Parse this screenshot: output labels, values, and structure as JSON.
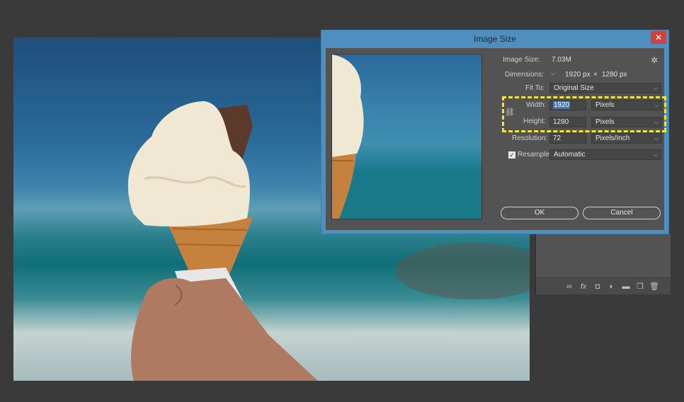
{
  "dialog": {
    "title": "Image Size",
    "close_label": "✕",
    "image_size_label": "Image Size:",
    "image_size_value": "7.03M",
    "dimensions_label": "Dimensions:",
    "dimensions_width": "1920 px",
    "dimensions_times": "×",
    "dimensions_height": "1280 px",
    "fit_to_label": "Fit To:",
    "fit_to_value": "Original Size",
    "width_label": "Width:",
    "width_value": "1920",
    "width_unit": "Pixels",
    "height_label": "Height:",
    "height_value": "1280",
    "height_unit": "Pixels",
    "resolution_label": "Resolution:",
    "resolution_value": "72",
    "resolution_unit": "Pixels/Inch",
    "resample_label": "Resample:",
    "resample_checked": true,
    "resample_value": "Automatic",
    "ok_label": "OK",
    "cancel_label": "Cancel"
  },
  "icons": {
    "gear": "gear-icon",
    "chain": "chain-link-icon",
    "chevron": "chevron-down-icon",
    "dimensions_toggle": "chevron-down-icon"
  },
  "layers_footer": [
    "link-icon",
    "fx-icon",
    "mask-icon",
    "adjustment-icon",
    "folder-icon",
    "new-layer-icon",
    "trash-icon"
  ],
  "colors": {
    "dialog_frame": "#4f8fc0",
    "panel": "#535353",
    "highlight": "#f2e33a",
    "close": "#c7453e",
    "selection": "#3d78b8"
  }
}
